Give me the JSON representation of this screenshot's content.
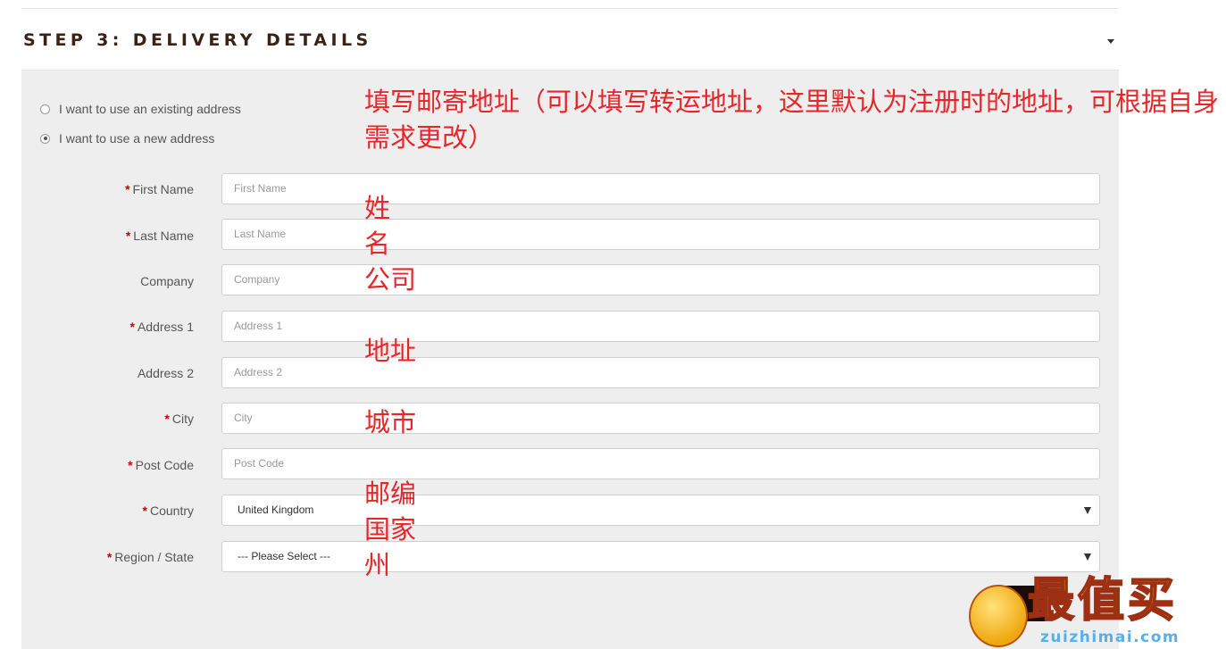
{
  "header": {
    "title": "STEP 3: DELIVERY DETAILS"
  },
  "address_choice": {
    "existing_label": "I want to use an existing address",
    "new_label": "I want to use a new address",
    "selected": "new"
  },
  "form": {
    "first_name": {
      "label": "First Name",
      "placeholder": "First Name",
      "required": true
    },
    "last_name": {
      "label": "Last Name",
      "placeholder": "Last Name",
      "required": true
    },
    "company": {
      "label": "Company",
      "placeholder": "Company",
      "required": false
    },
    "address_1": {
      "label": "Address 1",
      "placeholder": "Address 1",
      "required": true
    },
    "address_2": {
      "label": "Address 2",
      "placeholder": "Address 2",
      "required": false
    },
    "city": {
      "label": "City",
      "placeholder": "City",
      "required": true
    },
    "post_code": {
      "label": "Post Code",
      "placeholder": "Post Code",
      "required": true
    },
    "country": {
      "label": "Country",
      "value": "United Kingdom",
      "required": true
    },
    "region": {
      "label": "Region / State",
      "value": "--- Please Select ---",
      "required": true
    }
  },
  "annotations": {
    "main": "填写邮寄地址（可以填写转运地址，这里默认为注册时的地址，可根据自身需求更改）",
    "first_name": "姓",
    "last_name": "名",
    "company": "公司",
    "address": "地址",
    "city": "城市",
    "post_code": "邮编",
    "country": "国家",
    "region": "州"
  },
  "watermark": {
    "title": "最值买",
    "url": "zuizhimai.com"
  },
  "colors": {
    "annotation": "#e8262a",
    "required": "#cc0000",
    "heading": "#3a2216",
    "panel": "#eeeeee"
  }
}
